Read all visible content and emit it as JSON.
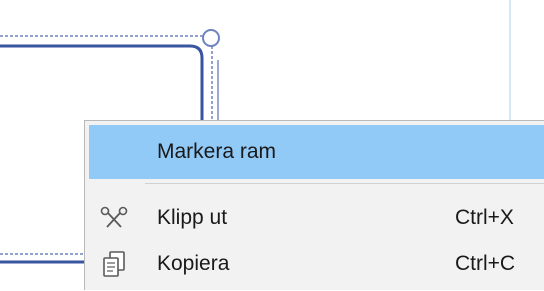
{
  "context_menu": {
    "items": [
      {
        "label": "Markera ram",
        "shortcut": "",
        "icon": ""
      },
      {
        "label": "Klipp ut",
        "shortcut": "Ctrl+X",
        "icon": "scissors-icon"
      },
      {
        "label": "Kopiera",
        "shortcut": "Ctrl+C",
        "icon": "copy-icon"
      }
    ],
    "highlighted_index": 0
  },
  "colors": {
    "connector": "#3a55a0",
    "dotted": "#6f83c0",
    "highlight": "#91c9f7",
    "menu_bg": "#f2f2f2"
  }
}
